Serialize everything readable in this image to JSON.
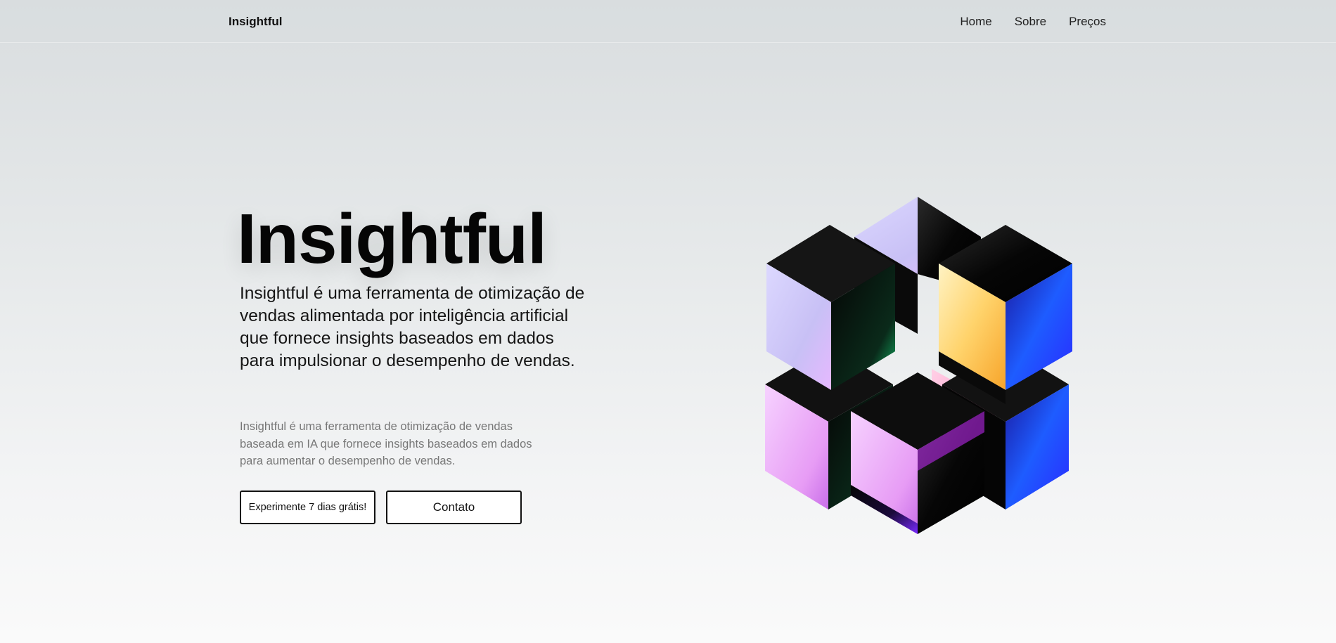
{
  "nav": {
    "brand": "Insightful",
    "links": [
      "Home",
      "Sobre",
      "Preços"
    ]
  },
  "hero": {
    "title": "Insightful",
    "lead": "Insightful é uma ferramenta de otimização de vendas alimentada por inteligência artificial que fornece insights baseados em dados para impulsionar o desempenho de vendas.",
    "subtext": "Insightful é uma ferramenta de otimização de vendas baseada em IA que fornece insights baseados em dados para aumentar o desempenho de vendas.",
    "buttons": {
      "trial_label": "Experimente 7 dias grátis!",
      "contact_label": "Contato"
    }
  },
  "illustration": {
    "icon": "iridescent-cubes-illustration"
  }
}
